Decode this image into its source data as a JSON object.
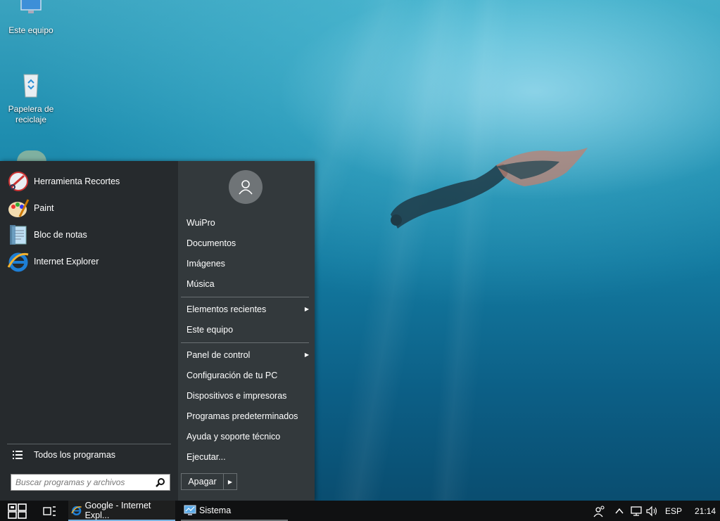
{
  "desktop": {
    "icons": [
      {
        "label": "Este equipo"
      },
      {
        "label": "Papelera de reciclaje"
      }
    ]
  },
  "start_menu": {
    "programs": [
      {
        "label": "Herramienta Recortes",
        "icon": "snipping-tool-icon"
      },
      {
        "label": "Paint",
        "icon": "paint-icon"
      },
      {
        "label": "Bloc de notas",
        "icon": "notepad-icon"
      },
      {
        "label": "Internet Explorer",
        "icon": "internet-explorer-icon"
      }
    ],
    "all_programs": "Todos los programas",
    "search_placeholder": "Buscar programas y archivos",
    "right": {
      "user_folders": [
        "WuiPro",
        "Documentos",
        "Imágenes",
        "Música"
      ],
      "group2": [
        "Elementos recientes",
        "Este equipo"
      ],
      "group3": [
        "Panel de control",
        "Configuración de tu PC",
        "Dispositivos e impresoras",
        "Programas predeterminados",
        "Ayuda y soporte técnico",
        "Ejecutar..."
      ]
    },
    "shutdown_label": "Apagar"
  },
  "taskbar": {
    "apps": [
      {
        "label": "Google - Internet Expl...",
        "icon": "internet-explorer-icon",
        "active": true
      },
      {
        "label": "Sistema",
        "icon": "system-monitor-icon",
        "active": false
      }
    ],
    "language": "ESP",
    "clock": "21:14"
  },
  "colors": {
    "menu_left": "#262a2d",
    "menu_right": "#33393c",
    "taskbar": "#101112",
    "accent": "#7ab3e0"
  }
}
